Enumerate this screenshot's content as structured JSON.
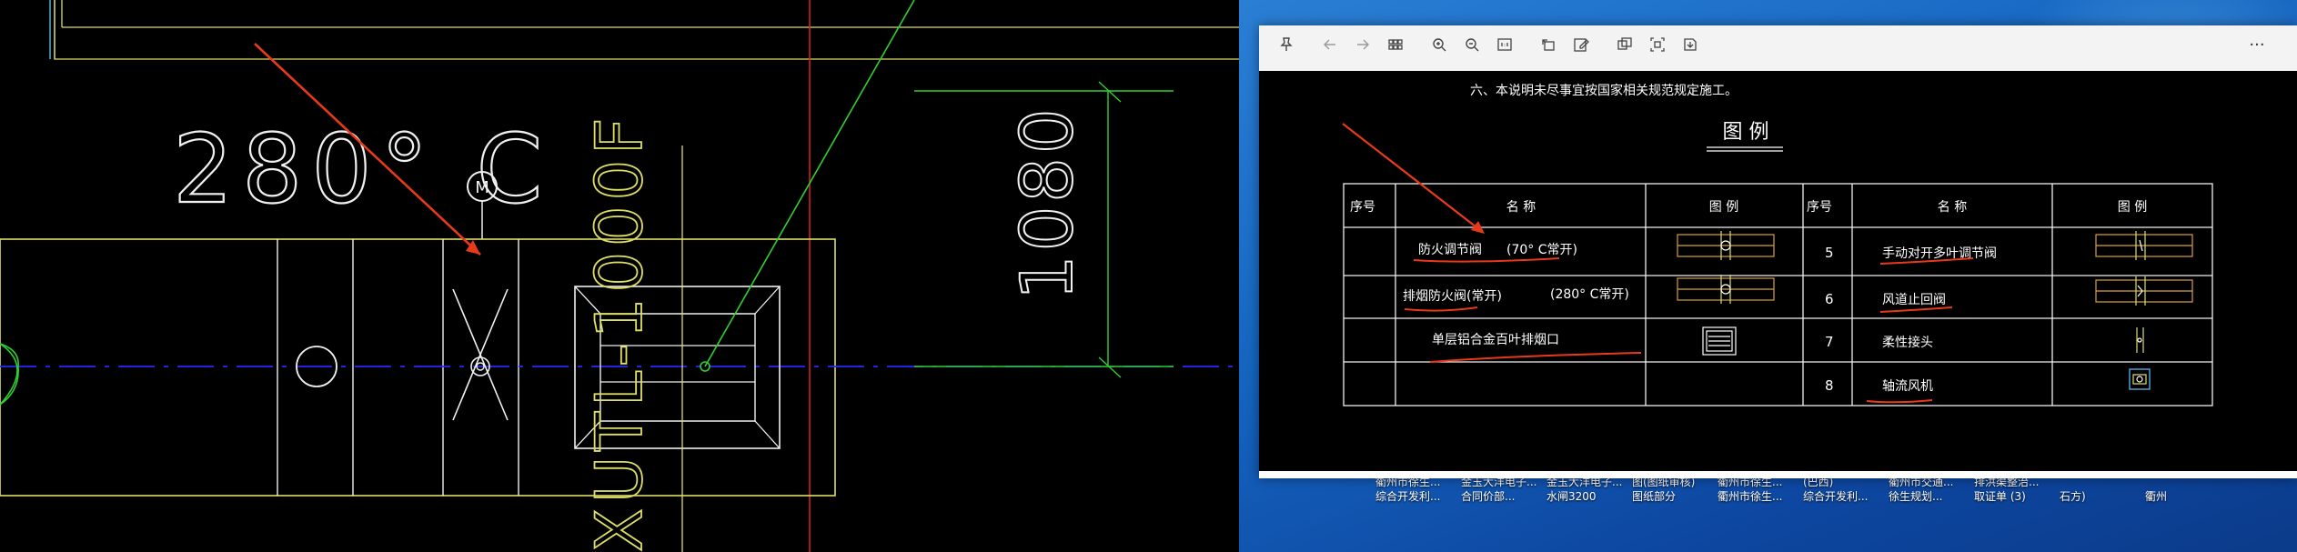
{
  "cad": {
    "dimension_temp": "280° C",
    "motor_label": "M",
    "vertical_dim": "1080",
    "vertical_model": "XUTL-1000F"
  },
  "viewer": {
    "toolbar": {
      "pin": "pin-icon",
      "back": "back-icon",
      "forward": "forward-icon",
      "grid": "grid-icon",
      "zoom_in": "zoom-in-icon",
      "zoom_out": "zoom-out-icon",
      "actual_size": "actual-size-icon",
      "rotate": "rotate-icon",
      "edit": "edit-icon",
      "copy": "copy-icon",
      "crop": "crop-icon",
      "save": "save-icon",
      "more": "···"
    },
    "document": {
      "note_line": "六、本说明未尽事宜按国家相关规范规定施工。",
      "legend_title": "图  例",
      "headers": {
        "seq": "序号",
        "name": "名   称",
        "legend": "图   例",
        "seq2": "序号",
        "name2": "名   称",
        "legend2": "图   例"
      },
      "rows_left": [
        {
          "seq": "",
          "name": "防火调节阀",
          "note": "(70° C常开)"
        },
        {
          "seq": "",
          "name": "排烟防火阀(常开)",
          "note": "(280° C常开)"
        },
        {
          "seq": "",
          "name": "单层铝合金百叶排烟口",
          "note": ""
        },
        {
          "seq": "",
          "name": "",
          "note": ""
        }
      ],
      "rows_right": [
        {
          "seq": "5",
          "name": "手动对开多叶调节阀"
        },
        {
          "seq": "6",
          "name": "风道止回阀"
        },
        {
          "seq": "7",
          "name": "柔性接头"
        },
        {
          "seq": "8",
          "name": "轴流风机"
        }
      ]
    }
  },
  "desktop": {
    "row1": [
      "衢州市徐生...",
      "金玉大洋电子...",
      "金玉大洋电子...",
      "图(图纸审核)",
      "衢州市徐生...",
      "(巴西)",
      "衢州市交通...",
      "排洪渠整治..."
    ],
    "row2": [
      "综合开发利...",
      "合同价部...",
      "水闸3200",
      "图纸部分",
      "衢州市徐生...",
      "综合开发利...",
      "徐生规划...",
      "取证单 (3)",
      "石方)",
      "衢州"
    ]
  },
  "colors": {
    "cad_yellow": "#e8e84a",
    "cad_white": "#f0f0f0",
    "cad_green": "#2fd02f",
    "cad_red": "#e02020",
    "cad_blue": "#2222ee",
    "annot_red": "#e83a1a"
  }
}
